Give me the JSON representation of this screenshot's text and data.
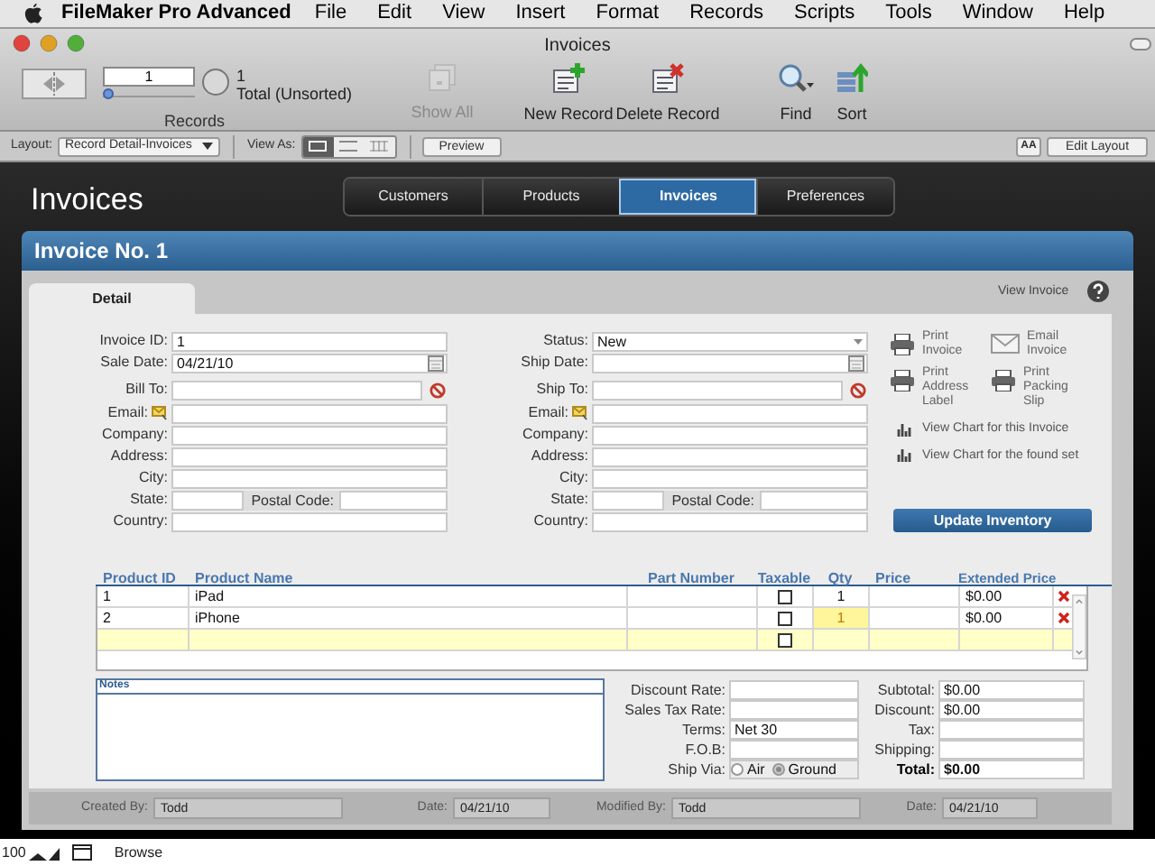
{
  "menu_bar": {
    "app": "FileMaker Pro Advanced",
    "items": [
      "File",
      "Edit",
      "View",
      "Insert",
      "Format",
      "Records",
      "Scripts",
      "Tools",
      "Window",
      "Help"
    ]
  },
  "window": {
    "title": "Invoices"
  },
  "toolbar": {
    "record_number": "1",
    "found_count": "1",
    "sort_status": "Total (Unsorted)",
    "records_label": "Records",
    "level": 0.0,
    "buttons": [
      {
        "kind": "show_all",
        "label": "Show All",
        "disabled": true
      },
      {
        "kind": "new",
        "label": "New Record",
        "disabled": false
      },
      {
        "kind": "delete",
        "label": "Delete Record",
        "disabled": false
      },
      {
        "kind": "find",
        "label": "Find",
        "disabled": false
      },
      {
        "kind": "sort",
        "label": "Sort",
        "disabled": false
      }
    ]
  },
  "layout_bar": {
    "layout_label": "Layout:",
    "layout": "Record Detail-Invoices",
    "view_as_label": "View As:",
    "view_modes": [
      {
        "kind": "form",
        "selected": true
      },
      {
        "kind": "list",
        "selected": false
      },
      {
        "kind": "table",
        "selected": false
      }
    ],
    "preview": "Preview",
    "text_size": "AA",
    "edit_layout": "Edit Layout"
  },
  "header": {
    "title": "Invoices",
    "nav_tabs": [
      {
        "label": "Customers",
        "selected": false
      },
      {
        "label": "Products",
        "selected": false
      },
      {
        "label": "Invoices",
        "selected": true
      },
      {
        "label": "Preferences",
        "selected": false
      }
    ]
  },
  "invoice": {
    "title": "Invoice No. 1",
    "tabs": [
      {
        "label": "Detail",
        "selected": true
      }
    ],
    "view_invoice": "View Invoice"
  },
  "bill_fields": [
    {
      "kind": "text",
      "label": "Invoice ID:",
      "value": "1"
    },
    {
      "kind": "date",
      "label": "Sale Date:",
      "value": "04/21/10"
    },
    {
      "kind": "lookup",
      "label": "Bill To:"
    },
    {
      "kind": "email",
      "label": "Email:"
    },
    {
      "kind": "text",
      "label": "Company:"
    },
    {
      "kind": "text",
      "label": "Address:"
    },
    {
      "kind": "text",
      "label": "City:"
    },
    {
      "kind": "state",
      "label": "State:",
      "postal_label": "Postal Code:"
    },
    {
      "kind": "text",
      "label": "Country:"
    }
  ],
  "ship_fields": [
    {
      "kind": "dropdown",
      "label": "Status:",
      "value": "New"
    },
    {
      "kind": "date",
      "label": "Ship Date:"
    },
    {
      "kind": "lookup",
      "label": "Ship To:"
    },
    {
      "kind": "email",
      "label": "Email:"
    },
    {
      "kind": "text",
      "label": "Company:"
    },
    {
      "kind": "text",
      "label": "Address:"
    },
    {
      "kind": "text",
      "label": "City:"
    },
    {
      "kind": "state",
      "label": "State:",
      "postal_label": "Postal Code:"
    },
    {
      "kind": "text",
      "label": "Country:"
    }
  ],
  "actions": [
    {
      "kind": "print",
      "label": "Print Invoice"
    },
    {
      "kind": "email",
      "label": "Email Invoice"
    },
    {
      "kind": "print",
      "label": "Print Address Label"
    },
    {
      "kind": "print",
      "label": "Print Packing Slip"
    }
  ],
  "chart_links": [
    "View Chart for this Invoice",
    "View Chart for the found set"
  ],
  "update_button": "Update Inventory",
  "line_items": {
    "columns": [
      "Product ID",
      "Product Name",
      "Part Number",
      "Taxable",
      "Qty",
      "Price",
      "Extended Price"
    ],
    "rows": [
      {
        "kind": "item",
        "product_id": "1",
        "product_name": "iPad",
        "taxable": false,
        "qty": "1",
        "qty_highlighted": false,
        "extended_price": "$0.00"
      },
      {
        "kind": "item",
        "product_id": "2",
        "product_name": "iPhone",
        "taxable": false,
        "qty": "1",
        "qty_highlighted": true,
        "extended_price": "$0.00"
      },
      {
        "kind": "new",
        "taxable": false
      }
    ]
  },
  "notes": {
    "label": "Notes"
  },
  "terms_fields": [
    {
      "kind": "text",
      "label": "Discount Rate:"
    },
    {
      "kind": "text",
      "label": "Sales Tax Rate:"
    },
    {
      "kind": "text",
      "label": "Terms:",
      "value": "Net 30"
    },
    {
      "kind": "text",
      "label": "F.O.B:"
    },
    {
      "kind": "radio",
      "label": "Ship Via:",
      "options": [
        {
          "label": "Air",
          "selected": false
        },
        {
          "label": "Ground",
          "selected": true
        }
      ]
    }
  ],
  "totals": [
    {
      "label": "Subtotal:",
      "value": "$0.00",
      "bold": false
    },
    {
      "label": "Discount:",
      "value": "$0.00",
      "bold": false
    },
    {
      "label": "Tax:",
      "bold": false
    },
    {
      "label": "Shipping:",
      "bold": false
    },
    {
      "label": "Total:",
      "value": "$0.00",
      "bold": true
    }
  ],
  "footer": [
    {
      "label": "Created By:",
      "value": "Todd"
    },
    {
      "label": "Date:",
      "value": "04/21/10"
    },
    {
      "label": "Modified By:",
      "value": "Todd"
    },
    {
      "label": "Date:",
      "value": "04/21/10"
    }
  ],
  "status_bar": {
    "zoom": "100",
    "mode": "Browse"
  }
}
